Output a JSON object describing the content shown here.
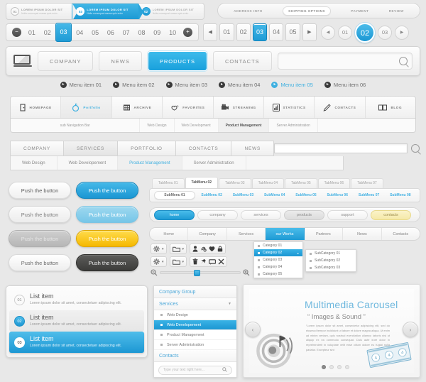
{
  "steps": {
    "items": [
      {
        "num": "01",
        "title": "LOREM IPSUM DOLOR SIT",
        "sub": "Nulla consequat massa quis enim"
      },
      {
        "num": "03",
        "title": "LOREM IPSUM DOLOR SIT",
        "sub": "Nulla consequat massa quis enim"
      },
      {
        "num": "02",
        "title": "LOREM IPSUM DOLOR SIT",
        "sub": "Nulla consequat massa quis enim"
      }
    ]
  },
  "checkout_steps": {
    "items": [
      "ADDRESS INFO",
      "SHIPPING OPTIONS",
      "PAYMENT",
      "REVIEW"
    ],
    "active": "SHIPPING OPTIONS"
  },
  "pagination_wide": {
    "prev_icon": "minus-circle-icon",
    "next_icon": "plus-circle-icon",
    "pages": [
      "01",
      "02",
      "03",
      "04",
      "05",
      "06",
      "07",
      "08",
      "09",
      "10"
    ],
    "active": "03"
  },
  "pagination_boxed": {
    "prev": "◀",
    "next": "▶",
    "pages": [
      "01",
      "02",
      "03",
      "04",
      "05"
    ],
    "active": "03"
  },
  "pagination_round": {
    "prev": "◀",
    "next": "▶",
    "pages": [
      "01",
      "02",
      "03"
    ],
    "active": "02"
  },
  "mainnav": {
    "logo_icon": "laptop-icon",
    "buttons": [
      "COMPANY",
      "NEWS",
      "PRODUCTS",
      "CONTACTS"
    ],
    "active": "PRODUCTS",
    "search": {
      "value": "",
      "placeholder": "",
      "icon": "search-icon"
    }
  },
  "menustrip": {
    "items": [
      "Menu item  01",
      "Menu item  02",
      "Menu item  03",
      "Menu item  04",
      "Menu item  05",
      "Menu item  06"
    ],
    "active_index": 4
  },
  "iconnav": {
    "items": [
      {
        "label": "HOMEPAGE",
        "icon": "door-icon"
      },
      {
        "label": "Portfolio",
        "icon": "target-icon"
      },
      {
        "label": "ARCHIVE",
        "icon": "archive-icon"
      },
      {
        "label": "FAVORITES",
        "icon": "heart-hand-icon"
      },
      {
        "label": "STREAMING",
        "icon": "camera-icon"
      },
      {
        "label": "STATISTICS",
        "icon": "bar-chart-icon"
      },
      {
        "label": "CONTACTS",
        "icon": "pen-icon"
      },
      {
        "label": "BLOG",
        "icon": "book-icon"
      }
    ],
    "active": "Portfolio",
    "subnav": [
      "sub Navigation Bar",
      "Web Design",
      "Web Development",
      "Product Management",
      "Server Administration"
    ],
    "subnav_active": "Product Management"
  },
  "tabbar": {
    "tabs": [
      "COMPANY",
      "SERVICES",
      "PORTFOLIO",
      "CONTACTS",
      "NEWS"
    ],
    "search": {
      "value": "",
      "icon": "search-icon"
    },
    "subtabs": [
      "Web Design",
      "Web Developement",
      "Product Management",
      "Server Administration"
    ],
    "subtabs_active": "Product Management"
  },
  "buttons": {
    "label": "Push the button",
    "variants": [
      "white",
      "white2",
      "gray",
      "white3",
      "blue",
      "blue-l",
      "yellow",
      "dark"
    ]
  },
  "tabmenu": {
    "tabs": [
      "TabMenu 01",
      "TabMenu 02",
      "TabMenu 03",
      "TabMenu 04",
      "TabMenu 05",
      "TabMenu 06",
      "TabMenu 07"
    ],
    "active": "TabMenu 02",
    "submenus": [
      "SubMenu 01",
      "SubMenu 02",
      "SubMenu 03",
      "SubMenu 04",
      "SubMenu 05",
      "SubMenu 06",
      "SubMenu 07",
      "SubMenu 08"
    ],
    "submenu_active": "SubMenu 01"
  },
  "pills": {
    "items": [
      "home",
      "company",
      "services",
      "products",
      "support",
      "contacts"
    ],
    "active": "home",
    "pressed": "products",
    "highlight": "contacts"
  },
  "segtabs": {
    "items": [
      "Home",
      "Company",
      "Services",
      "our Works",
      "Partners",
      "News",
      "Contacts"
    ],
    "active": "our Works"
  },
  "toolbar": {
    "row1": [
      "gear-icon",
      "chevron-down-icon",
      "folder-icon",
      "chevron-down-icon",
      "user-icon",
      "link-icon",
      "heart-icon",
      "lock-icon"
    ],
    "row2": [
      "gear-icon",
      "chevron-down-icon",
      "folder-icon",
      "chevron-down-icon",
      "trash-icon",
      "pin-icon",
      "comment-icon",
      "close-icon"
    ],
    "slider": {
      "zoom_out_icon": "zoom-out-icon",
      "zoom_in_icon": "zoom-in-icon",
      "value": 42
    }
  },
  "categories": {
    "items": [
      "Category 01",
      "Category 02",
      "Category 03",
      "Category 04",
      "Category 05"
    ],
    "active": "Category 02",
    "subitems": [
      "SubCategory 01",
      "SubCategory 02",
      "SubCategory 03"
    ]
  },
  "list": {
    "items": [
      {
        "badge": "01",
        "title": "List item",
        "sub": "Lorem ipsum dolor sit amet, consectetuer adipiscing elit."
      },
      {
        "badge": "02",
        "title": "List item",
        "sub": "Lorem ipsum dolor sit amet, consectetuer adipiscing elit."
      },
      {
        "badge": "03",
        "title": "List item",
        "sub": "Lorem ipsum dolor sit amet, consectetuer adipiscing elit."
      }
    ],
    "selected_index": 2
  },
  "accordion": {
    "header1": "Company Group",
    "header2": "Services",
    "caret_icon": "chevron-down-icon",
    "items": [
      "Web Design",
      "Web Developement",
      "Product Management",
      "Server Administration"
    ],
    "active": "Web Developement",
    "header3": "Contacts",
    "search": {
      "placeholder": "Type your text right here...",
      "icon": "search-icon"
    }
  },
  "carousel": {
    "title": "Multimedia Carousel",
    "subtitle": "“ Images & Sound ”",
    "body": "“Lorem ipsum dolor sit amet, consectetur adipisicing elit, sed do eiusmod tempor incididunt ut labore et dolore magna aliqua. Ut enim ad minim veniam, quis nostrud exercitation ullamco laboris nisi ut aliquip ex ea commodo consequat. Duis aute irure dolor in reprehenderit in voluptate velit esse cillum dolore eu fugiat nulla pariatur. Excepteur sint",
    "prev_icon": "chevron-left-icon",
    "next_icon": "chevron-right-icon",
    "dots": 4,
    "active_dot": 0,
    "speaker_icon": "speaker-icon",
    "tickets_icon": "film-tickets-icon"
  },
  "colors": {
    "accent_blue": "#1e9ad4",
    "accent_blue_light": "#49bcea",
    "yellow": "#f5e9a8",
    "dark": "#3c3c3a",
    "text_gray": "#8a8a8a"
  }
}
